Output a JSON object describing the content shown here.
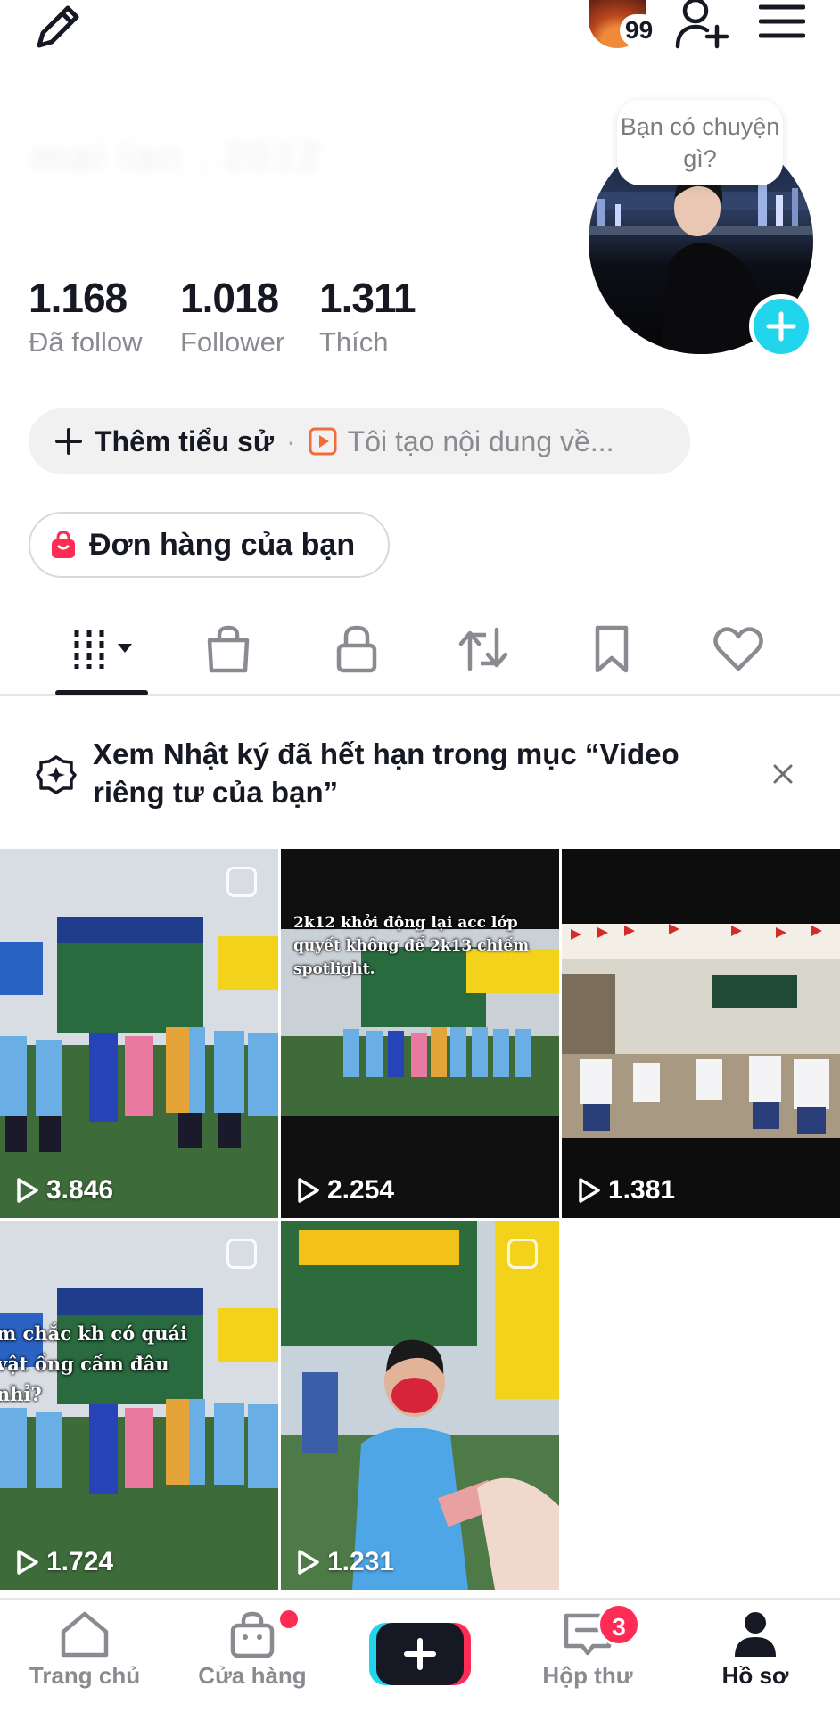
{
  "header": {
    "story_count": "99"
  },
  "profile": {
    "username": "mai lan . 2012",
    "note": "Bạn có chuyện gì?",
    "stats": [
      {
        "value": "1.168",
        "label": "Đã follow"
      },
      {
        "value": "1.018",
        "label": "Follower"
      },
      {
        "value": "1.311",
        "label": "Thích"
      }
    ],
    "bio_add_label": "Thêm tiểu sử",
    "bio_separator": "·",
    "bio_hint": "Tôi tạo nội dung về...",
    "orders_label": "Đơn hàng của bạn"
  },
  "tabs": [
    {
      "icon": "grid-icon",
      "active": true
    },
    {
      "icon": "shopping-bag-icon"
    },
    {
      "icon": "lock-icon"
    },
    {
      "icon": "repost-icon"
    },
    {
      "icon": "bookmark-icon"
    },
    {
      "icon": "heart-icon"
    }
  ],
  "notice": {
    "text": "Xem Nhật ký đã hết hạn trong mục “Video riêng tư của bạn”"
  },
  "videos": [
    {
      "views": "3.846"
    },
    {
      "views": "2.254",
      "caption": "2k12 khởi động lại acc lớp quyết không để 2k13 chiếm spotlight."
    },
    {
      "views": "1.381"
    },
    {
      "views": "1.724",
      "caption": "m chắc kh có quái vật ồng cấm đâu nhỉ?"
    },
    {
      "views": "1.231"
    }
  ],
  "nav": {
    "home": "Trang chủ",
    "shop": "Cửa hàng",
    "inbox": "Hộp thư",
    "inbox_badge": "3",
    "profile": "Hồ sơ"
  },
  "colors": {
    "accent_cyan": "#20d5ec",
    "accent_red": "#fe2c55",
    "text_primary": "#161823",
    "text_secondary": "#8a8b91"
  }
}
